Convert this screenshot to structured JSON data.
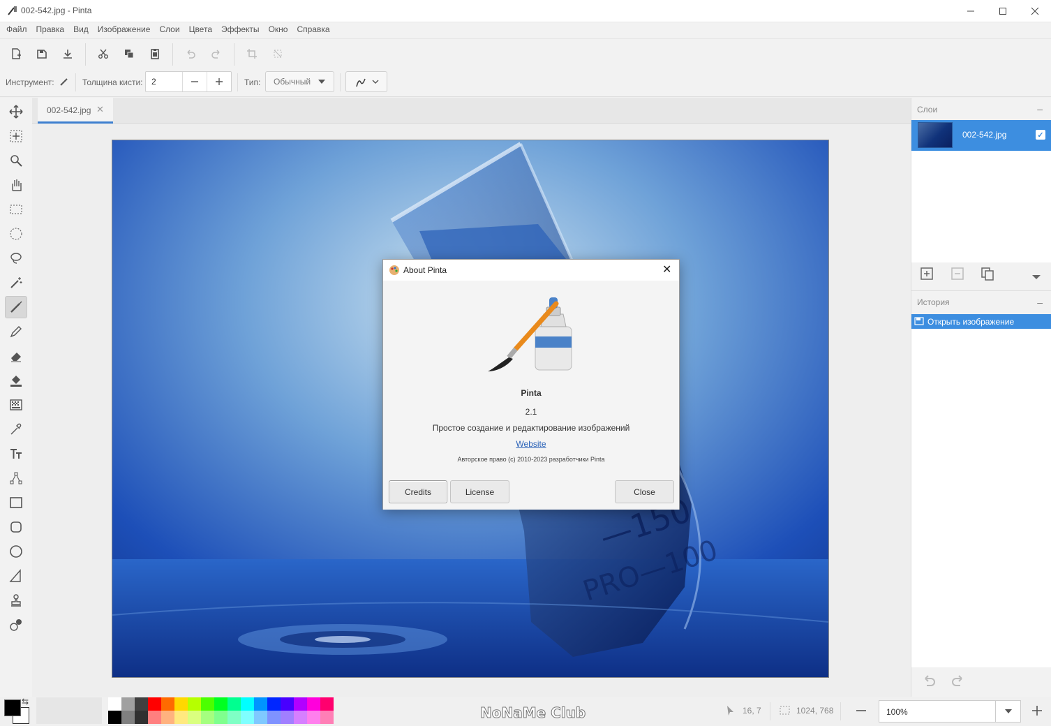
{
  "window": {
    "title": "002-542.jpg - Pinta"
  },
  "menu": [
    "Файл",
    "Правка",
    "Вид",
    "Изображение",
    "Слои",
    "Цвета",
    "Эффекты",
    "Окно",
    "Справка"
  ],
  "options": {
    "tool_label": "Инструмент:",
    "brush_width_label": "Толщина кисти:",
    "brush_width_value": "2",
    "type_label": "Тип:",
    "type_value": "Обычный"
  },
  "document": {
    "tab_name": "002-542.jpg"
  },
  "layers_panel": {
    "title": "Слои",
    "layers": [
      {
        "name": "002-542.jpg",
        "visible": true
      }
    ]
  },
  "history_panel": {
    "title": "История",
    "items": [
      "Открыть изображение"
    ]
  },
  "about": {
    "title": "About Pinta",
    "app_name": "Pinta",
    "version": "2.1",
    "description": "Простое создание и редактирование изображений",
    "website_label": "Website",
    "copyright": "Авторское право (c) 2010-2023 разработчики Pinta",
    "buttons": {
      "credits": "Credits",
      "license": "License",
      "close": "Close"
    }
  },
  "status": {
    "cursor": "16, 7",
    "selection_size": "1024, 768",
    "zoom": "100%",
    "watermark": "NoNaMe Club"
  },
  "palette": {
    "primary": "#000000",
    "secondary": "#ffffff",
    "top": [
      "#ffffff",
      "#a0a0a0",
      "#404040",
      "#ff0000",
      "#ff6a00",
      "#ffd800",
      "#b6ff00",
      "#4cff00",
      "#00ff21",
      "#00ff90",
      "#00ffff",
      "#0094ff",
      "#0026ff",
      "#4800ff",
      "#b200ff",
      "#ff00dc",
      "#ff006e"
    ],
    "bottom": [
      "#000000",
      "#808080",
      "#303030",
      "#ff7f7f",
      "#ffb27f",
      "#ffe97f",
      "#daff7f",
      "#a5ff7f",
      "#7fff8e",
      "#7fffc5",
      "#7fffff",
      "#7fc9ff",
      "#7f92ff",
      "#a17fff",
      "#d67fff",
      "#ff7fed",
      "#ff7fb6"
    ]
  }
}
